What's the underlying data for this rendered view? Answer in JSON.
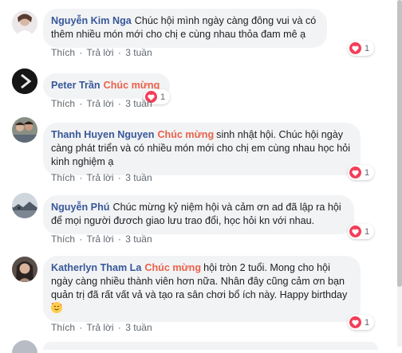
{
  "actions": {
    "like": "Thích",
    "reply": "Trả lời",
    "separator": "·"
  },
  "comments": [
    {
      "author": "Nguyễn Kim Nga",
      "tag": "",
      "text": "Chúc hội mình ngày càng đông vui và có thêm nhiều món mới cho chị e cùng nhau thỏa đam mê ạ",
      "time": "3 tuần",
      "reaction_count": "1",
      "avatar": "avatar-woman-light"
    },
    {
      "author": "Peter Trần",
      "tag": "Chúc mừng",
      "text": "",
      "time": "3 tuần",
      "reaction_count": "1",
      "avatar": "avatar-dark"
    },
    {
      "author": "Thanh Huyen Nguyen",
      "tag": "Chúc mừng",
      "text": "sinh nhật hội. Chúc hội ngày càng phát triển và có nhiều món mới cho chị em cùng nhau học hỏi kinh nghiệm ạ",
      "time": "3 tuần",
      "reaction_count": "1",
      "avatar": "avatar-group-photo"
    },
    {
      "author": "Nguyễn Phú",
      "tag": "",
      "text": "Chúc mừng kỷ niệm hội và cảm ơn ad đã lập ra hội để mọi người đươch giao lưu trao đổi, học hỏi kn với nhau.",
      "time": "3 tuần",
      "reaction_count": "1",
      "avatar": "avatar-landscape"
    },
    {
      "author": "Katherlyn Tham La",
      "tag": "Chúc mừng",
      "text": "hội tròn 2 tuổi. Mong cho hội ngày càng nhiều thành viên hơn nữa. Nhân đây cũng cảm ơn bạn quản trị đã rất vất vả và tạo ra sân chơi bổ ích này. Happy birthday",
      "time": "3 tuần",
      "reaction_count": "1",
      "avatar": "avatar-woman-portrait",
      "trailing_icon": "smiling-face-hearts-icon"
    }
  ],
  "colors": {
    "author": "#385898",
    "tag": "#e9624b",
    "bubble": "#f2f3f5",
    "heart": "#f33e58"
  }
}
